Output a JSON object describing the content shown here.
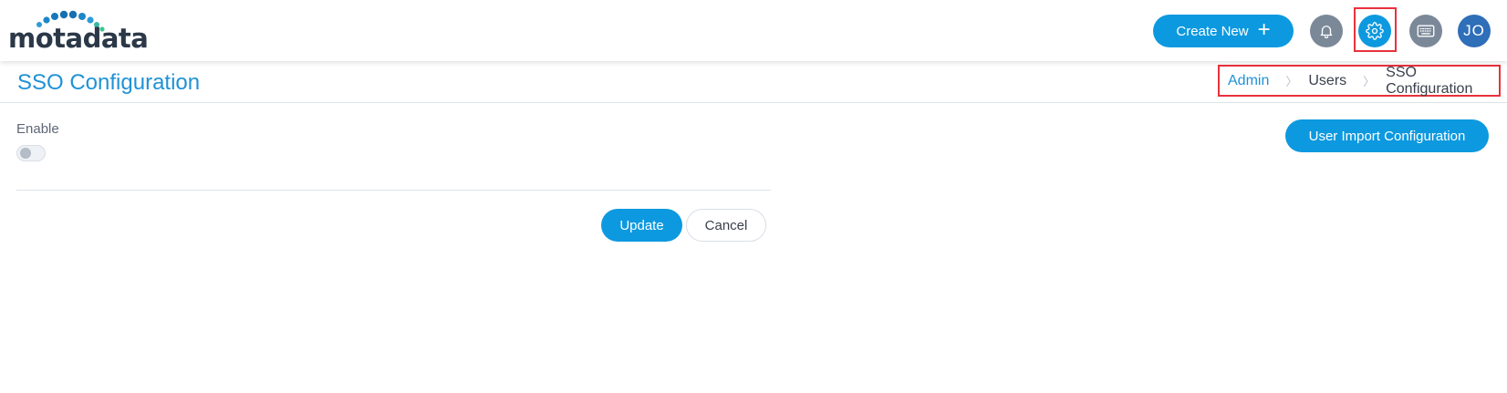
{
  "header": {
    "logo_text": "motadata",
    "create_new_label": "Create New",
    "create_new_icon": "plus-icon",
    "icons": [
      "bell-icon",
      "gear-icon",
      "keyboard-icon"
    ],
    "avatar_initials": "JO",
    "accent_color": "#0d99df",
    "highlight_color": "#e8323c"
  },
  "page": {
    "title": "SSO Configuration",
    "breadcrumb": [
      "Admin",
      "Users",
      "SSO Configuration"
    ]
  },
  "form": {
    "enable_label": "Enable",
    "enable_toggle_on": false,
    "import_button_label": "User Import Configuration",
    "update_label": "Update",
    "cancel_label": "Cancel"
  }
}
